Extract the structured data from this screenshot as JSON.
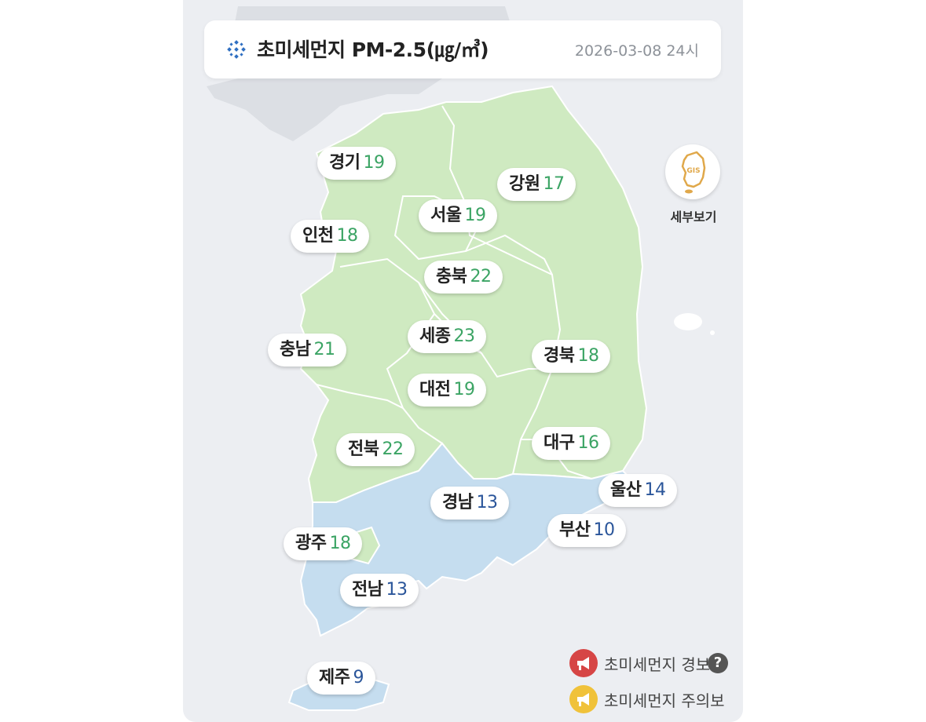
{
  "header": {
    "title": "초미세먼지 PM-2.5(㎍/㎥)",
    "datetime": "2026-03-08 24시",
    "icon": "dust-icon"
  },
  "regions": [
    {
      "id": "gyeonggi",
      "name": "경기",
      "value": "19",
      "level": "normal"
    },
    {
      "id": "gangwon",
      "name": "강원",
      "value": "17",
      "level": "normal"
    },
    {
      "id": "seoul",
      "name": "서울",
      "value": "19",
      "level": "normal"
    },
    {
      "id": "incheon",
      "name": "인천",
      "value": "18",
      "level": "normal"
    },
    {
      "id": "chungbuk",
      "name": "충북",
      "value": "22",
      "level": "normal"
    },
    {
      "id": "sejong",
      "name": "세종",
      "value": "23",
      "level": "normal"
    },
    {
      "id": "chungnam",
      "name": "충남",
      "value": "21",
      "level": "normal"
    },
    {
      "id": "gyeongbuk",
      "name": "경북",
      "value": "18",
      "level": "normal"
    },
    {
      "id": "daejeon",
      "name": "대전",
      "value": "19",
      "level": "normal"
    },
    {
      "id": "jeonbuk",
      "name": "전북",
      "value": "22",
      "level": "normal"
    },
    {
      "id": "daegu",
      "name": "대구",
      "value": "16",
      "level": "normal"
    },
    {
      "id": "ulsan",
      "name": "울산",
      "value": "14",
      "level": "good"
    },
    {
      "id": "gyeongnam",
      "name": "경남",
      "value": "13",
      "level": "good"
    },
    {
      "id": "busan",
      "name": "부산",
      "value": "10",
      "level": "good"
    },
    {
      "id": "gwangju",
      "name": "광주",
      "value": "18",
      "level": "normal"
    },
    {
      "id": "jeonnam",
      "name": "전남",
      "value": "13",
      "level": "good"
    },
    {
      "id": "jeju",
      "name": "제주",
      "value": "9",
      "level": "good"
    }
  ],
  "gis_button": {
    "label": "세부보기",
    "icon_text": "GIS",
    "icon": "korea-map-icon"
  },
  "legend": [
    {
      "label": "초미세먼지 경보",
      "color": "#d64545",
      "icon": "megaphone-icon",
      "help": "?"
    },
    {
      "label": "초미세먼지 주의보",
      "color": "#f0c23a",
      "icon": "megaphone-icon"
    }
  ],
  "colors": {
    "normal_fill": "#cfeac1",
    "good_fill": "#c5ddef",
    "normal_text": "#3ba464",
    "good_text": "#2a559a",
    "background": "#eceef2"
  }
}
